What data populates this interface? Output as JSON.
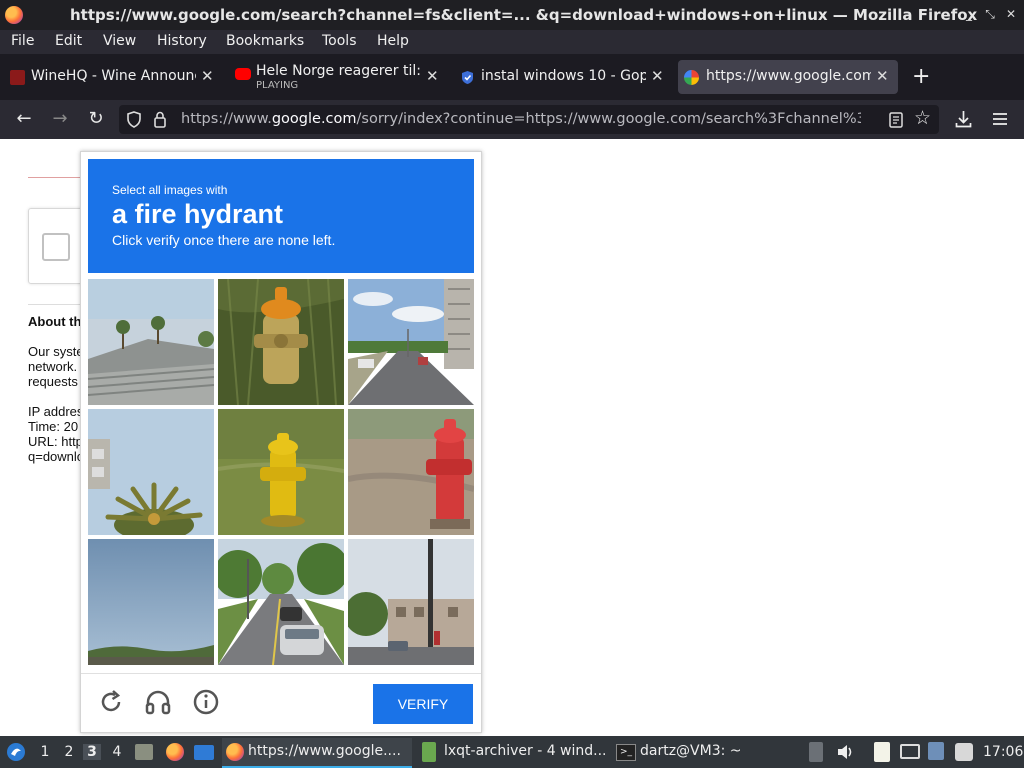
{
  "window": {
    "title": "https://www.google.com/search?channel=fs&client=... &q=download+windows+on+linux — Mozilla Firefox"
  },
  "menu": [
    "File",
    "Edit",
    "View",
    "History",
    "Bookmarks",
    "Tools",
    "Help"
  ],
  "tabs": [
    {
      "label": "WineHQ - Wine Announce",
      "icon": "wine-icon"
    },
    {
      "label": "Hele Norge reagerer til: ",
      "sub": "PLAYING",
      "icon": "youtube-icon"
    },
    {
      "label": "instal windows 10 - Goph",
      "icon": "shield-icon"
    },
    {
      "label": "https://www.google.com/",
      "icon": "google-icon",
      "active": true
    }
  ],
  "new_tab": "+",
  "urlbar": {
    "prefix": "https://www.",
    "host": "google.com",
    "path": "/sorry/index?continue=https://www.google.com/search%3Fchannel%3Dfs%"
  },
  "page_behind": {
    "heading": "About th",
    "para1": [
      "Our syste",
      "network.",
      "requests"
    ],
    "para2": [
      "IP addres",
      "Time: 20",
      "URL: http",
      "q=downlo"
    ]
  },
  "captcha": {
    "line1": "Select all images with",
    "target": "a fire hydrant",
    "line3": "Click verify once there are none left.",
    "tiles": [
      {
        "name": "tile-rooftop-palms"
      },
      {
        "name": "tile-orange-hydrant"
      },
      {
        "name": "tile-road-building"
      },
      {
        "name": "tile-palm-tree"
      },
      {
        "name": "tile-yellow-hydrant"
      },
      {
        "name": "tile-red-hydrant"
      },
      {
        "name": "tile-sky-horizon"
      },
      {
        "name": "tile-street-car"
      },
      {
        "name": "tile-street-pole"
      }
    ],
    "verify": "VERIFY"
  },
  "taskbar": {
    "workspaces": [
      "1",
      "2",
      "3",
      "4"
    ],
    "tasks": [
      {
        "label": "https://www.google....",
        "icon": "firefox-icon"
      },
      {
        "label": "lxqt-archiver - 4 wind...",
        "icon": "archive-icon"
      },
      {
        "label": "dartz@VM3: ~",
        "icon": "terminal-icon"
      }
    ],
    "clock": "17:06"
  }
}
